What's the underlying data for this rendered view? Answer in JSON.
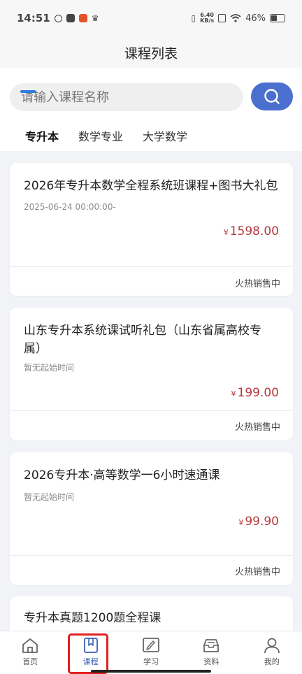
{
  "status_bar": {
    "time": "14:51",
    "speed_value": "6.40",
    "speed_unit": "KB/s",
    "battery": "46%",
    "battery_level": 0.46
  },
  "header": {
    "title": "课程列表"
  },
  "search": {
    "placeholder": "请输入课程名称"
  },
  "tabs": [
    {
      "label": "专升本",
      "active": true
    },
    {
      "label": "数学专业",
      "active": false
    },
    {
      "label": "大学数学",
      "active": false
    }
  ],
  "courses": [
    {
      "title": "2026年专升本数学全程系统班课程+图书大礼包",
      "date": "2025-06-24 00:00:00-",
      "price_symbol": "¥",
      "price": "1598.00",
      "status": "火热销售中"
    },
    {
      "title": "山东专升本系统课试听礼包（山东省属高校专属）",
      "date": "暂无起始时间",
      "price_symbol": "¥",
      "price": "199.00",
      "status": "火热销售中"
    },
    {
      "title": "2026专升本·高等数学一6小时速通课",
      "date": "暂无起始时间",
      "price_symbol": "¥",
      "price": "99.90",
      "status": "火热销售中"
    },
    {
      "title": "专升本真题1200题全程课"
    }
  ],
  "bottom_nav": [
    {
      "label": "首页",
      "icon": "home-icon"
    },
    {
      "label": "课程",
      "icon": "course-icon",
      "active": true
    },
    {
      "label": "学习",
      "icon": "study-icon"
    },
    {
      "label": "资料",
      "icon": "materials-icon"
    },
    {
      "label": "我的",
      "icon": "profile-icon"
    }
  ],
  "colors": {
    "accent": "#4a6fcf",
    "price": "#b8383d",
    "tab_underline": "#2f7de1",
    "highlight": "#e02020"
  }
}
